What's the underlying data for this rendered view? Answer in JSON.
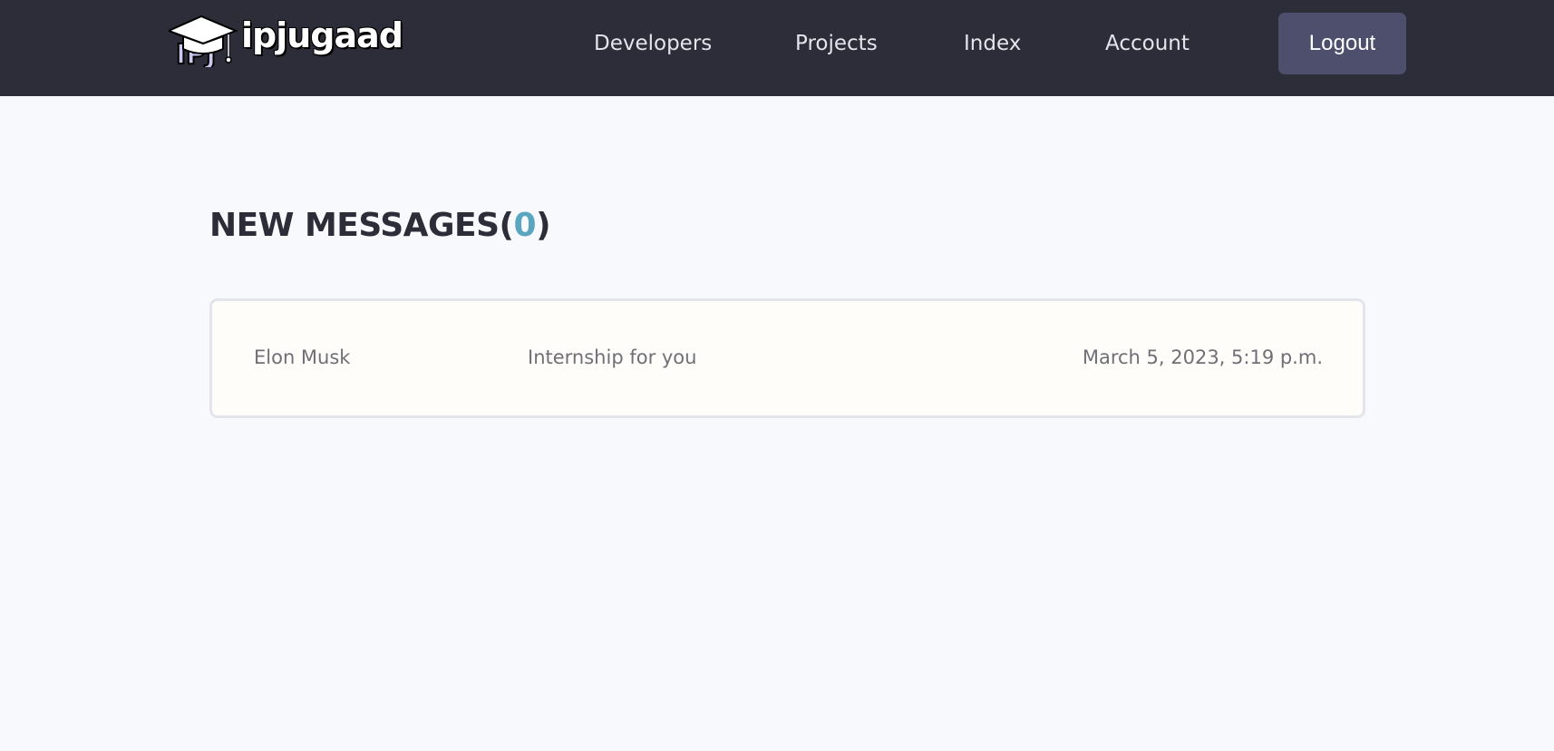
{
  "brand": {
    "mark_text": "IPJ",
    "name": "ipjugaad"
  },
  "nav": {
    "items": [
      {
        "label": "Developers"
      },
      {
        "label": "Projects"
      },
      {
        "label": "Index"
      },
      {
        "label": "Account"
      }
    ],
    "logout_label": "Logout"
  },
  "inbox": {
    "title": "NEW MESSAGES",
    "open_paren": "(",
    "unread_count": "0",
    "close_paren": ")",
    "messages": [
      {
        "sender": "Elon Musk",
        "subject": "Internship for you",
        "date": "March 5, 2023, 5:19 p.m."
      }
    ]
  },
  "colors": {
    "header_bg": "#2d2d39",
    "page_bg": "#f8f9fd",
    "logout_bg": "#4d4f6c",
    "count_accent": "#5aa5c0",
    "card_bg": "#fffdfa"
  },
  "icons": {
    "logo": "graduation-cap-icon"
  }
}
